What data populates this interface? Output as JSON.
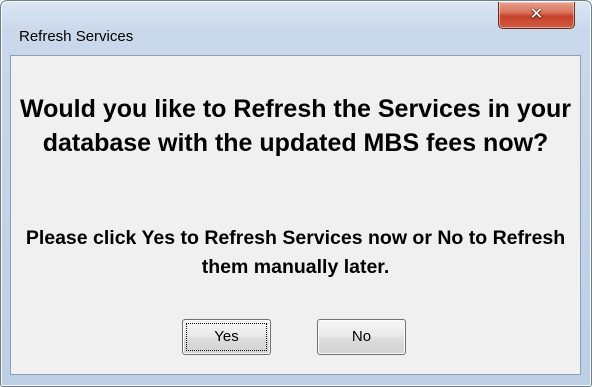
{
  "window": {
    "title": "Refresh Services",
    "close_icon": "✕"
  },
  "message": {
    "question": "Would you like to Refresh the Services in your database with the updated MBS fees now?",
    "instruction": "Please click Yes to Refresh Services now or No to Refresh them manually later."
  },
  "buttons": {
    "yes_label": "Yes",
    "no_label": "No"
  },
  "icons": {
    "close": "close-icon"
  },
  "colors": {
    "close_button": "#c7402a",
    "frame": "#bccfe5",
    "client": "#f0f0f0"
  }
}
